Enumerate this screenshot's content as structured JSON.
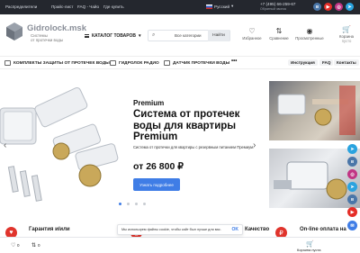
{
  "topbar": {
    "links": [
      "Распределители",
      "Прайс-лист",
      "FAQ - Чайо",
      "Где купить"
    ],
    "language": "Русский",
    "phone": "+7 (495) 66-259-67",
    "phone_sub": "Обратный звонок"
  },
  "social": [
    {
      "name": "vk-icon",
      "color": "#4a76a8",
      "glyph": "в"
    },
    {
      "name": "youtube-icon",
      "color": "#e52d27",
      "glyph": "▶"
    },
    {
      "name": "instagram-icon",
      "color": "#c13584",
      "glyph": "◎"
    },
    {
      "name": "telegram-icon",
      "color": "#2aa3df",
      "glyph": "➤"
    }
  ],
  "logo": {
    "title": "Gidrolock.msk",
    "subtitle_line1": "Системы",
    "subtitle_line2": "от протечки воды"
  },
  "catalog": {
    "label": "КАТАЛОГ ТОВАРОВ"
  },
  "search": {
    "category": "Все категории",
    "button": "Найти",
    "placeholder": ""
  },
  "header_icons": [
    {
      "name": "favorites-icon",
      "glyph": "♡",
      "label": "Избранное"
    },
    {
      "name": "compare-icon",
      "glyph": "⇅",
      "label": "Сравнение"
    },
    {
      "name": "viewed-icon",
      "glyph": "◉",
      "label": "Просмотренные"
    }
  ],
  "cart": {
    "label": "Корзина",
    "sub": "пусто"
  },
  "nav": {
    "items": [
      "КОМПЛЕКТЫ ЗАЩИТЫ ОТ ПРОТЕЧЕК ВОДЫ",
      "ГИДРОЛОК РАДИО",
      "ДАТЧИК ПРОТЕЧКИ ВОДЫ"
    ],
    "more": "•••",
    "right": [
      "Инструкция",
      "FAQ",
      "Контакты"
    ]
  },
  "hero": {
    "label": "Premium",
    "title": "Система от протечек воды для квартиры Premium",
    "description": "Система от протечки для квартиры с резервным питанием Премиум.",
    "price": "от 26 800 ₽",
    "cta": "Узнать подробнее",
    "prev": "‹",
    "next": "›",
    "slides_total": 4,
    "slide_active": 1
  },
  "features": [
    {
      "glyph": "♥",
      "title": "Гарантия и/или"
    },
    {
      "glyph": "◉",
      "title": "Качество"
    },
    {
      "glyph": "₽",
      "title": "On-line оплата на"
    }
  ],
  "cookie": {
    "text": "Мы используем файлы cookie, чтобы сайт был лучше для вас.",
    "ok": "OK"
  },
  "mobile_bar": {
    "fav_count": "0",
    "compare_count": "0",
    "cart_label": "Корзина пуста"
  },
  "floating_buttons": [
    {
      "name": "telegram-fab-icon",
      "color": "#2aa3df",
      "glyph": "➤"
    },
    {
      "name": "vk-fab-icon",
      "color": "#4a76a8",
      "glyph": "в"
    },
    {
      "name": "instagram-fab-icon",
      "color": "#c13584",
      "glyph": "◎"
    },
    {
      "name": "telegram2-fab-icon",
      "color": "#2aa3df",
      "glyph": "➤"
    },
    {
      "name": "vk2-fab-icon",
      "color": "#4a76a8",
      "glyph": "в"
    },
    {
      "name": "youtube-fab-icon",
      "color": "#e52d27",
      "glyph": "▶"
    },
    {
      "name": "chat-fab-icon",
      "color": "#3f7de6",
      "glyph": "✉"
    }
  ]
}
